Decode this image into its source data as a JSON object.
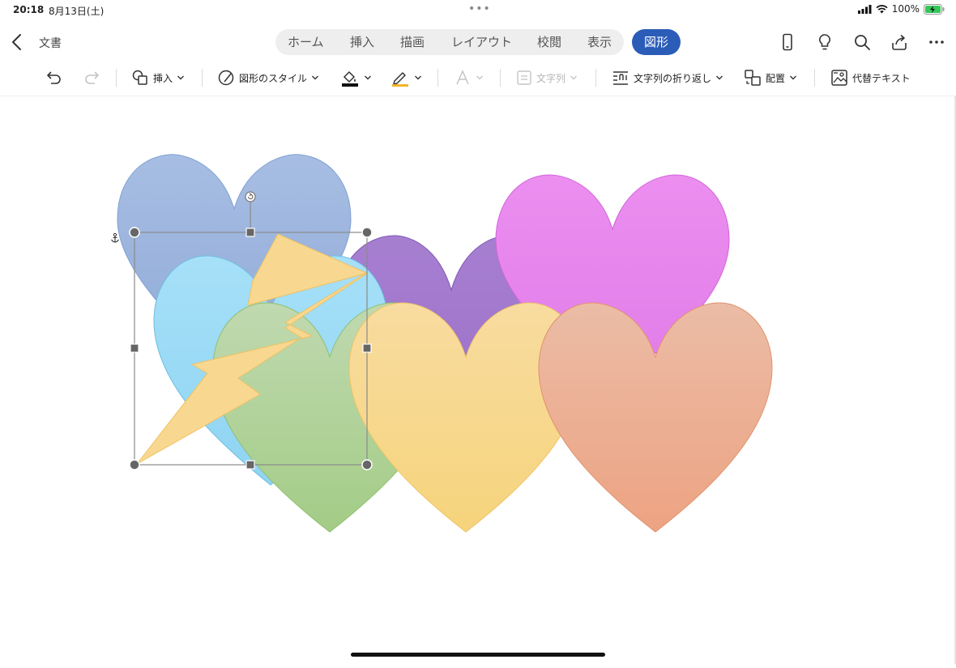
{
  "status": {
    "time": "20:18",
    "date": "8月13日(土)",
    "battery": "100%"
  },
  "nav": {
    "doc_title": "文書",
    "tabs": [
      "ホーム",
      "挿入",
      "描画",
      "レイアウト",
      "校閲",
      "表示"
    ],
    "active_tab": "図形"
  },
  "toolbar": {
    "insert": "挿入",
    "shape_styles": "図形のスタイル",
    "text_direction": "文字列",
    "wrap_text": "文字列の折り返し",
    "arrange": "配置",
    "alt_text": "代替テキスト"
  },
  "colors": {
    "accent": "#2b5cb8",
    "heart_steel_blue": "#a7bde3",
    "heart_sky_blue": "#9fdcf6",
    "heart_purple": "#a67fd0",
    "heart_magenta": "#ec8ef0",
    "heart_green": "#b4d49e",
    "heart_yellow": "#f8d88e",
    "heart_peach": "#ebb49b",
    "lightning": "#f8d890"
  }
}
